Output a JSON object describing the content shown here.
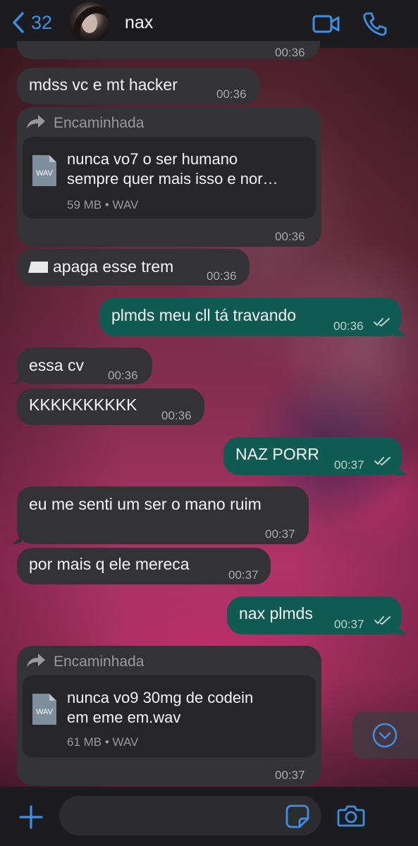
{
  "header": {
    "back_count": "32",
    "contact_name": "nax",
    "accent_color": "#3d8fe6"
  },
  "messages": [
    {
      "kind": "partial_time",
      "time": "00:36"
    },
    {
      "kind": "in",
      "text": "mdss vc e mt hacker",
      "time": "00:36"
    },
    {
      "kind": "forward_file",
      "forward_label": "Encaminhada",
      "file_type": "WAV",
      "file_name_line1": "nunca vo7 o ser humano",
      "file_name_line2": "sempre quer mais isso e nor…",
      "file_meta": "59 MB • WAV",
      "time": "00:36"
    },
    {
      "kind": "in",
      "text": "apaga esse trem",
      "time": "00:36"
    },
    {
      "kind": "out",
      "text": "plmds meu cll tá travando",
      "time": "00:36"
    },
    {
      "kind": "in",
      "text": "essa cv",
      "time": "00:36"
    },
    {
      "kind": "in",
      "text": "KKKKKKKKKK",
      "time": "00:36"
    },
    {
      "kind": "out",
      "text": "NAZ PORR",
      "time": "00:37"
    },
    {
      "kind": "in",
      "text": "eu me senti um ser o mano ruim",
      "time": "00:37"
    },
    {
      "kind": "in",
      "text": "por mais q ele mereca",
      "time": "00:37"
    },
    {
      "kind": "out",
      "text": "nax plmds",
      "time": "00:37"
    },
    {
      "kind": "forward_file",
      "forward_label": "Encaminhada",
      "file_type": "WAV",
      "file_name_line1": "nunca vo9 30mg de codein",
      "file_name_line2": "em eme em.wav",
      "file_meta": "61 MB • WAV",
      "time": "00:37"
    }
  ],
  "composer": {
    "placeholder": ""
  },
  "icons": {
    "back": "chevron-left-icon",
    "video": "video-camera-icon",
    "phone": "phone-icon",
    "forward": "forward-arrow-icon",
    "file": "wav-file-icon",
    "read": "double-check-icon",
    "scroll": "chevron-down-circle-icon",
    "plus": "plus-icon",
    "sticker": "sticker-icon",
    "camera": "camera-icon"
  }
}
